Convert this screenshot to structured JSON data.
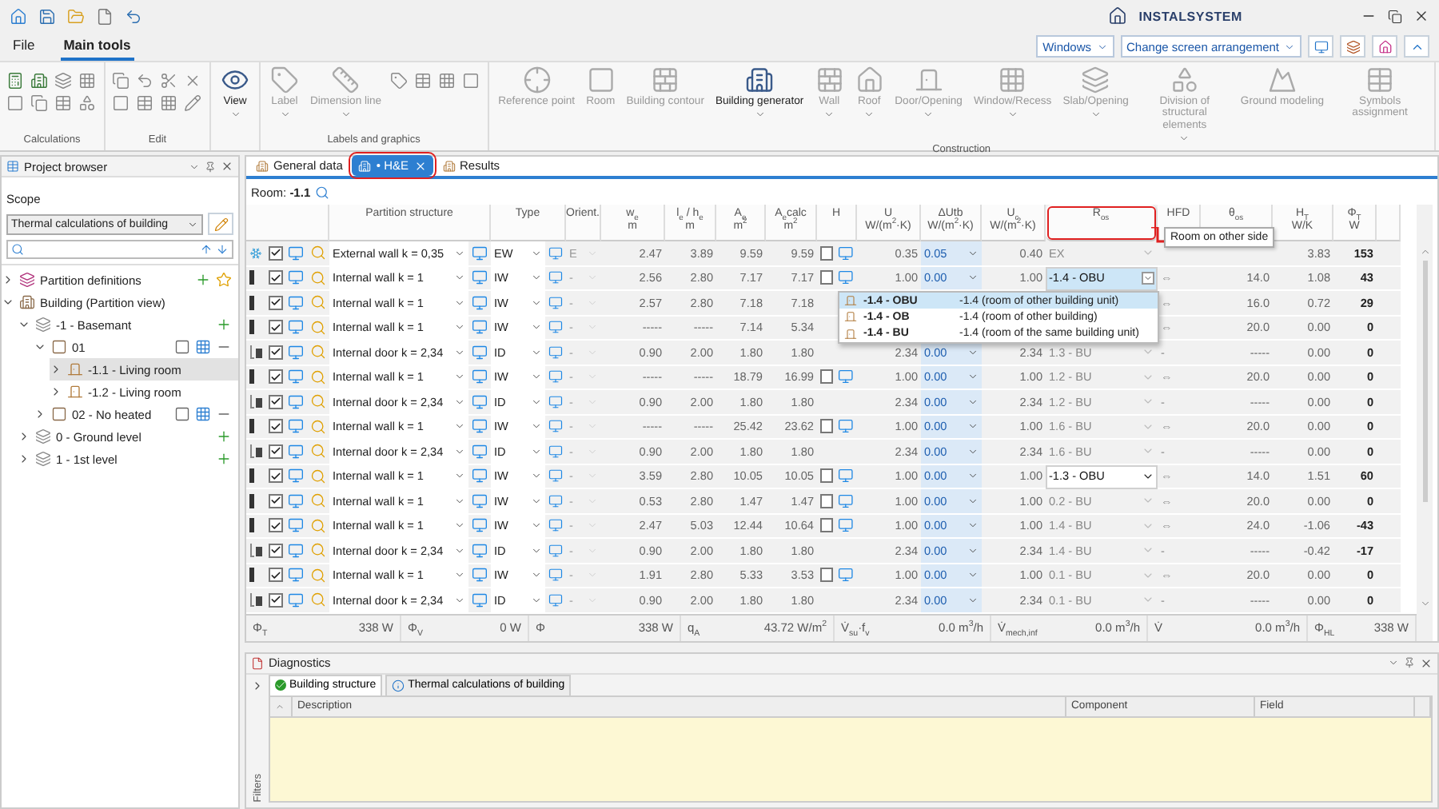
{
  "app": {
    "logo": "INSTALSYSTEM"
  },
  "menu_tabs": [
    {
      "label": "File",
      "selected": false
    },
    {
      "label": "Main tools",
      "selected": true
    }
  ],
  "window_selects": [
    "Windows",
    "Change screen arrangement"
  ],
  "ribbon": [
    {
      "title": "Calculations",
      "kind": "calculations"
    },
    {
      "title": "Edit",
      "kind": "edit"
    },
    {
      "kind": "view",
      "buttons": [
        {
          "label": "View",
          "menu": true,
          "disabled": false
        }
      ]
    },
    {
      "title": "Labels and graphics",
      "kind": "labels",
      "buttons": [
        {
          "label": "Label",
          "menu": true,
          "disabled": true
        },
        {
          "label": "Dimension line",
          "menu": true,
          "disabled": true
        }
      ]
    },
    {
      "title": "Construction",
      "kind": "construction",
      "buttons": [
        {
          "label": "Reference point",
          "menu": false,
          "disabled": true
        },
        {
          "label": "Room",
          "menu": false,
          "disabled": true
        },
        {
          "label": "Building contour",
          "menu": false,
          "disabled": true
        },
        {
          "label": "Building generator",
          "menu": true,
          "disabled": false
        },
        {
          "label": "Wall",
          "menu": true,
          "disabled": true
        },
        {
          "label": "Roof",
          "menu": true,
          "disabled": true
        },
        {
          "label": "Door/Opening",
          "menu": true,
          "disabled": true
        },
        {
          "label": "Window/Recess",
          "menu": true,
          "disabled": true
        },
        {
          "label": "Slab/Opening",
          "menu": true,
          "disabled": true
        },
        {
          "label": "Division of structural elements",
          "menu": true,
          "disabled": true
        },
        {
          "label": "Ground modeling",
          "menu": false,
          "disabled": true
        },
        {
          "label": "Symbols assignment",
          "menu": false,
          "disabled": true
        }
      ]
    }
  ],
  "browser": {
    "title": "Project browser",
    "scope_label": "Scope",
    "scope": "Thermal calculations of building",
    "tree": [
      {
        "label": "Partition definitions",
        "kind": "definitions",
        "expanded": false,
        "selected": false
      },
      {
        "label": "Building (Partition view)",
        "kind": "building",
        "expanded": true,
        "selected": false,
        "children": [
          {
            "label": "-1 - Basemant",
            "kind": "level",
            "expanded": true,
            "selected": false,
            "children": [
              {
                "label": "01",
                "kind": "zone",
                "expanded": true,
                "selected": false,
                "children": [
                  {
                    "label": "-1.1 - Living room",
                    "kind": "room",
                    "expanded": false,
                    "selected": true
                  },
                  {
                    "label": "-1.2 - Living room",
                    "kind": "room",
                    "expanded": false,
                    "selected": false
                  }
                ]
              },
              {
                "label": "02 - No heated",
                "kind": "zone",
                "expanded": false,
                "selected": false
              }
            ]
          },
          {
            "label": "0 - Ground  level",
            "kind": "level",
            "expanded": false,
            "selected": false
          },
          {
            "label": "1 - 1st level",
            "kind": "level",
            "expanded": false,
            "selected": false
          }
        ]
      }
    ]
  },
  "doc_tabs": [
    {
      "label": "General data",
      "selected": false,
      "closable": false,
      "highlighted": false
    },
    {
      "label": "• H&E",
      "selected": true,
      "closable": true,
      "highlighted": true
    },
    {
      "label": "Results",
      "selected": false,
      "closable": false,
      "highlighted": false
    }
  ],
  "room": "Room: **-1.1**",
  "columns": [
    {
      "title": "Partition structure"
    },
    {
      "title": "Type"
    },
    {
      "title": "Orient."
    },
    {
      "title": "w$_{e}$",
      "unit": "m"
    },
    {
      "title": "l$_{e}$ / h$_{e}$",
      "unit": "m"
    },
    {
      "title": "A$_{e}$",
      "unit": "m$^{2}$"
    },
    {
      "title": "A$_{e}$calc",
      "unit": "m$^{2}$"
    },
    {
      "title": "H"
    },
    {
      "title": "U",
      "unit": "W/(m$^{2}$·K)"
    },
    {
      "title": "ΔUtb",
      "unit": "W/(m$^{2}$·K)"
    },
    {
      "title": "U$_{c}$",
      "unit": "W/(m$^{2}$·K)"
    },
    {
      "title": "R$_{os}$",
      "highlighted": true
    },
    {
      "title": "HFD"
    },
    {
      "title": "θ$_{os}$"
    },
    {
      "title": "H$_{T}$",
      "unit": "W/K"
    },
    {
      "title": "Φ$_{T}$",
      "unit": "W"
    }
  ],
  "rows": [
    {
      "kind": "external",
      "checked": true,
      "structure": "External wall k = 0,35",
      "type": "EW",
      "orient": "E",
      "we": "2.47",
      "le": "3.89",
      "ae": "9.59",
      "aecalc": "9.59",
      "h": {
        "checked": false
      },
      "u": "0.35",
      "dutb": "0.05",
      "uc": "0.40",
      "ros": "EX",
      "ros_field": false,
      "ros_open": false,
      "ht": "3.83",
      "phi": "153"
    },
    {
      "kind": "wall",
      "checked": true,
      "structure": "Internal wall k = 1",
      "type": "IW",
      "orient": "-",
      "we": "2.56",
      "le": "2.80",
      "ae": "7.17",
      "aecalc": "7.17",
      "h": {
        "checked": false
      },
      "u": "1.00",
      "dutb": "0.00",
      "uc": "1.00",
      "ros": "-1.4 - OBU",
      "ros_field": true,
      "ros_open": true,
      "hfd": "⇔",
      "theta": "14.0",
      "ht": "1.08",
      "phi": "43"
    },
    {
      "kind": "wall",
      "checked": true,
      "structure": "Internal wall k = 1",
      "type": "IW",
      "orient": "-",
      "we": "2.57",
      "le": "2.80",
      "ae": "7.18",
      "aecalc": "7.18",
      "hfd": "⇔",
      "theta": "16.0",
      "ht": "0.72",
      "phi": "29"
    },
    {
      "kind": "wall",
      "checked": true,
      "structure": "Internal wall k = 1",
      "type": "IW",
      "orient": "-",
      "we": "-----",
      "le": "-----",
      "ae": "7.14",
      "aecalc": "5.34",
      "hfd": "⇔",
      "theta": "20.0",
      "ht": "0.00",
      "phi": "0"
    },
    {
      "kind": "door",
      "checked": true,
      "structure": "Internal door k = 2,34",
      "type": "ID",
      "orient": "-",
      "we": "0.90",
      "le": "2.00",
      "ae": "1.80",
      "aecalc": "1.80",
      "u": "2.34",
      "dutb": "0.00",
      "uc": "2.34",
      "ros": "1.3 - BU",
      "ros_field": false,
      "ros_open": false,
      "hfd": "-",
      "theta": "-----",
      "ht": "0.00",
      "phi": "0"
    },
    {
      "kind": "wall",
      "checked": true,
      "structure": "Internal wall k = 1",
      "type": "IW",
      "orient": "-",
      "we": "-----",
      "le": "-----",
      "ae": "18.79",
      "aecalc": "16.99",
      "h": {
        "checked": false
      },
      "u": "1.00",
      "dutb": "0.00",
      "uc": "1.00",
      "ros": "1.2 - BU",
      "ros_field": false,
      "ros_open": false,
      "hfd": "⇔",
      "theta": "20.0",
      "ht": "0.00",
      "phi": "0"
    },
    {
      "kind": "door",
      "checked": true,
      "structure": "Internal door k = 2,34",
      "type": "ID",
      "orient": "-",
      "we": "0.90",
      "le": "2.00",
      "ae": "1.80",
      "aecalc": "1.80",
      "u": "2.34",
      "dutb": "0.00",
      "uc": "2.34",
      "ros": "1.2 - BU",
      "ros_field": false,
      "ros_open": false,
      "hfd": "-",
      "theta": "-----",
      "ht": "0.00",
      "phi": "0"
    },
    {
      "kind": "wall",
      "checked": true,
      "structure": "Internal wall k = 1",
      "type": "IW",
      "orient": "-",
      "we": "-----",
      "le": "-----",
      "ae": "25.42",
      "aecalc": "23.62",
      "h": {
        "checked": false
      },
      "u": "1.00",
      "dutb": "0.00",
      "uc": "1.00",
      "ros": "1.6 - BU",
      "ros_field": false,
      "ros_open": false,
      "hfd": "⇔",
      "theta": "20.0",
      "ht": "0.00",
      "phi": "0"
    },
    {
      "kind": "door",
      "checked": true,
      "structure": "Internal door k = 2,34",
      "type": "ID",
      "orient": "-",
      "we": "0.90",
      "le": "2.00",
      "ae": "1.80",
      "aecalc": "1.80",
      "u": "2.34",
      "dutb": "0.00",
      "uc": "2.34",
      "ros": "1.6 - BU",
      "ros_field": false,
      "ros_open": false,
      "hfd": "-",
      "theta": "-----",
      "ht": "0.00",
      "phi": "0"
    },
    {
      "kind": "wall",
      "checked": true,
      "structure": "Internal wall k = 1",
      "type": "IW",
      "orient": "-",
      "we": "3.59",
      "le": "2.80",
      "ae": "10.05",
      "aecalc": "10.05",
      "h": {
        "checked": false
      },
      "u": "1.00",
      "dutb": "0.00",
      "uc": "1.00",
      "ros": "-1.3 - OBU",
      "ros_field": true,
      "ros_open": false,
      "hfd": "⇔",
      "theta": "14.0",
      "ht": "1.51",
      "phi": "60"
    },
    {
      "kind": "wall",
      "checked": true,
      "structure": "Internal wall k = 1",
      "type": "IW",
      "orient": "-",
      "we": "0.53",
      "le": "2.80",
      "ae": "1.47",
      "aecalc": "1.47",
      "h": {
        "checked": false
      },
      "u": "1.00",
      "dutb": "0.00",
      "uc": "1.00",
      "ros": "0.2 - BU",
      "ros_field": false,
      "ros_open": false,
      "hfd": "⇔",
      "theta": "20.0",
      "ht": "0.00",
      "phi": "0"
    },
    {
      "kind": "wall",
      "checked": true,
      "structure": "Internal wall k = 1",
      "type": "IW",
      "orient": "-",
      "we": "2.47",
      "le": "5.03",
      "ae": "12.44",
      "aecalc": "10.64",
      "h": {
        "checked": false
      },
      "u": "1.00",
      "dutb": "0.00",
      "uc": "1.00",
      "ros": "1.4 - BU",
      "ros_field": false,
      "ros_open": false,
      "hfd": "⇔",
      "theta": "24.0",
      "ht": "-1.06",
      "phi": "-43"
    },
    {
      "kind": "door",
      "checked": true,
      "structure": "Internal door k = 2,34",
      "type": "ID",
      "orient": "-",
      "we": "0.90",
      "le": "2.00",
      "ae": "1.80",
      "aecalc": "1.80",
      "u": "2.34",
      "dutb": "0.00",
      "uc": "2.34",
      "ros": "1.4 - BU",
      "ros_field": false,
      "ros_open": false,
      "hfd": "-",
      "theta": "-----",
      "ht": "-0.42",
      "phi": "-17"
    },
    {
      "kind": "wall",
      "checked": true,
      "structure": "Internal wall k = 1",
      "type": "IW",
      "orient": "-",
      "we": "1.91",
      "le": "2.80",
      "ae": "5.33",
      "aecalc": "3.53",
      "h": {
        "checked": false
      },
      "u": "1.00",
      "dutb": "0.00",
      "uc": "1.00",
      "ros": "0.1 - BU",
      "ros_field": false,
      "ros_open": false,
      "hfd": "⇔",
      "theta": "20.0",
      "ht": "0.00",
      "phi": "0"
    },
    {
      "kind": "door",
      "checked": true,
      "structure": "Internal door k = 2,34",
      "type": "ID",
      "orient": "-",
      "we": "0.90",
      "le": "2.00",
      "ae": "1.80",
      "aecalc": "1.80",
      "u": "2.34",
      "dutb": "0.00",
      "uc": "2.34",
      "ros": "0.1 - BU",
      "ros_field": false,
      "ros_open": false,
      "hfd": "-",
      "theta": "-----",
      "ht": "0.00",
      "phi": "0"
    }
  ],
  "ros_options": [
    {
      "code": "-1.4 - OBU",
      "description": "-1.4 (room of other building unit)",
      "selected": true
    },
    {
      "code": "-1.4 - OB",
      "description": "-1.4 (room of other building)",
      "selected": false
    },
    {
      "code": "-1.4 - BU",
      "description": "-1.4 (room of the same building unit)",
      "selected": false
    }
  ],
  "tooltip": "Room on other side",
  "totals": [
    {
      "label": "Φ$_{T}$",
      "value": "338 W"
    },
    {
      "label": "Φ$_{V}$",
      "value": "0 W"
    },
    {
      "label": "Φ",
      "value": "338 W"
    },
    {
      "label": "q$_{A}$",
      "value": "43.72 W/m$^{2}$"
    },
    {
      "label": "V̇$_{su}$·f$_{v}$",
      "value": "0.0 m$^{3}$/h"
    },
    {
      "label": "V̇$_{mech,inf}$",
      "value": "0.0 m$^{3}$/h"
    },
    {
      "label": "V̇",
      "value": "0.0 m$^{3}$/h"
    },
    {
      "label": "Φ$_{HL}$",
      "value": "338 W"
    }
  ],
  "diagnostics": {
    "title": "Diagnostics",
    "filters": "Filters",
    "tabs": [
      {
        "label": "Building structure",
        "kind": "ok",
        "selected": true
      },
      {
        "label": "Thermal calculations of building",
        "kind": "info",
        "selected": false
      }
    ],
    "columns": [
      "Description",
      "Component",
      "Field"
    ]
  }
}
